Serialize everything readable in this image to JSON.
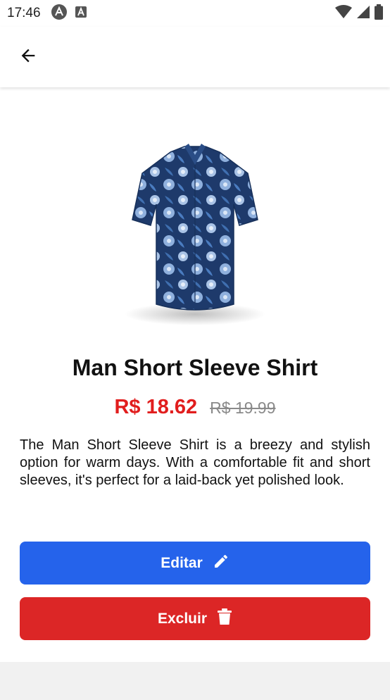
{
  "status_bar": {
    "time": "17:46",
    "left_icons": [
      "react-native-icon",
      "text-a-icon"
    ],
    "right_icons": [
      "wifi-icon",
      "signal-icon",
      "battery-icon"
    ]
  },
  "app_bar": {
    "back_icon": "arrow-left-icon"
  },
  "product": {
    "image_icon": "shirt-image",
    "name": "Man Short Sleeve Shirt",
    "price": "R$ 18.62",
    "original_price": "R$ 19.99",
    "description": "The Man Short Sleeve Shirt is a breezy and stylish option for warm days. With a comfortable fit and short sleeves, it's perfect for a laid-back yet polished look."
  },
  "actions": {
    "edit_label": "Editar",
    "edit_icon": "pencil-icon",
    "delete_label": "Excluir",
    "delete_icon": "trash-icon"
  },
  "colors": {
    "edit_button": "#2563eb",
    "delete_button": "#dc2626",
    "price": "#e11d1d",
    "old_price": "#8a8a8a"
  }
}
